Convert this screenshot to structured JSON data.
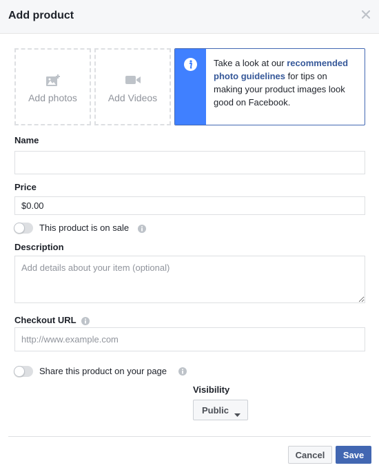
{
  "dialog": {
    "title": "Add product",
    "close_icon": "close-icon"
  },
  "media": {
    "photos_label": "Add photos",
    "photos_icon": "add-photo-icon",
    "videos_label": "Add Videos",
    "videos_icon": "video-camera-icon"
  },
  "info": {
    "icon": "info-icon",
    "text_before": "Take a look at our ",
    "link_text": "recommended photo guidelines",
    "text_after": " for tips on making your product images look good on Facebook.",
    "accent_color": "#4080ff"
  },
  "form": {
    "name_label": "Name",
    "name_value": "",
    "price_label": "Price",
    "price_value": "$0.00",
    "sale_toggle_label": "This product is on sale",
    "sale_toggle_on": false,
    "description_label": "Description",
    "description_placeholder": "Add details about your item (optional)",
    "checkout_url_label": "Checkout URL",
    "checkout_url_placeholder": "http://www.example.com",
    "share_toggle_label": "Share this product on your page",
    "share_toggle_on": false,
    "visibility_label": "Visibility",
    "visibility_value": "Public"
  },
  "footer": {
    "cancel_label": "Cancel",
    "save_label": "Save",
    "save_color": "#4267b2"
  }
}
